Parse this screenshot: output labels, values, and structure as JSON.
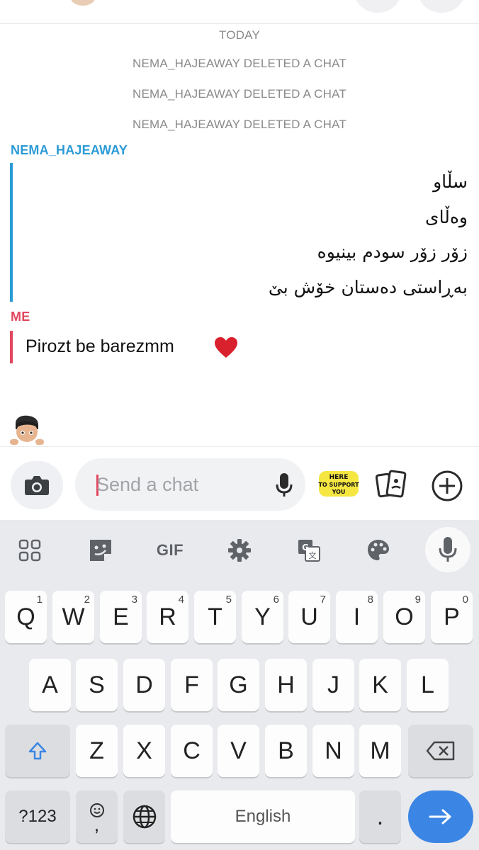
{
  "chat": {
    "date_header": "TODAY",
    "system_messages": [
      "NEMA_HAJEAWAY DELETED A CHAT",
      "NEMA_HAJEAWAY DELETED A CHAT",
      "NEMA_HAJEAWAY DELETED A CHAT"
    ],
    "contact_name": "NEMA_HAJEAWAY",
    "contact_messages": [
      "سڵاو",
      "وەڵای",
      "زۆر زۆر سودم بینیوە",
      "بەڕاستی دەستان خۆش بێ"
    ],
    "me_label": "ME",
    "my_message": "Pirozt be barezmm",
    "my_message_emoji": "heart-emoji"
  },
  "input_bar": {
    "placeholder": "Send a chat",
    "sticker_text": [
      "HERE",
      "TO SUPPORT",
      "YOU"
    ]
  },
  "keyboard": {
    "toolbar": {
      "gif_label": "GIF"
    },
    "row1": [
      {
        "label": "Q",
        "hint": "1"
      },
      {
        "label": "W",
        "hint": "2"
      },
      {
        "label": "E",
        "hint": "3"
      },
      {
        "label": "R",
        "hint": "4"
      },
      {
        "label": "T",
        "hint": "5"
      },
      {
        "label": "Y",
        "hint": "6"
      },
      {
        "label": "U",
        "hint": "7"
      },
      {
        "label": "I",
        "hint": "8"
      },
      {
        "label": "O",
        "hint": "9"
      },
      {
        "label": "P",
        "hint": "0"
      }
    ],
    "row2": [
      "A",
      "S",
      "D",
      "F",
      "G",
      "H",
      "J",
      "K",
      "L"
    ],
    "row3": [
      "Z",
      "X",
      "C",
      "V",
      "B",
      "N",
      "M"
    ],
    "symbols_label": "?123",
    "comma_label": ",",
    "space_label": "English",
    "period_label": "."
  },
  "colors": {
    "contact_accent": "#2b9bd6",
    "me_accent": "#e0485f",
    "enter_key": "#3b86e4"
  }
}
